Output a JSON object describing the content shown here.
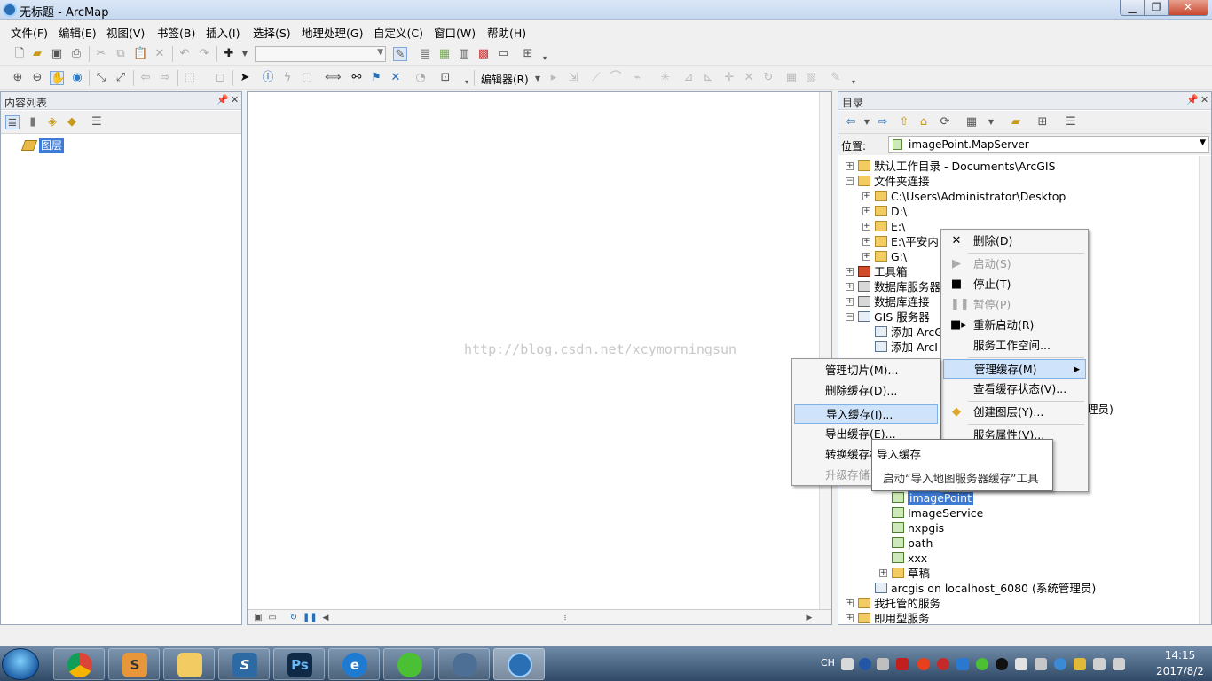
{
  "window": {
    "title": "无标题 - ArcMap"
  },
  "menubar": [
    "文件(F)",
    "编辑(E)",
    "视图(V)",
    "书签(B)",
    "插入(I)",
    "选择(S)",
    "地理处理(G)",
    "自定义(C)",
    "窗口(W)",
    "帮助(H)"
  ],
  "toolbar2": {
    "editor_label": "编辑器(R)"
  },
  "toc": {
    "title": "内容列表",
    "layers_label": "图层"
  },
  "catalog": {
    "title": "目录",
    "location_label": "位置:",
    "location_value": "imagePoint.MapServer",
    "tree": [
      {
        "label": "默认工作目录 - Documents\\ArcGIS",
        "icon": "folder-home-icon",
        "expand": "+"
      },
      {
        "label": "文件夹连接",
        "icon": "folder-connections-icon",
        "expand": "-"
      },
      {
        "label": "C:\\Users\\Administrator\\Desktop",
        "icon": "folder-icon",
        "expand": "+"
      },
      {
        "label": "D:\\",
        "icon": "folder-icon",
        "expand": "+"
      },
      {
        "label": "E:\\",
        "icon": "folder-icon",
        "expand": "+"
      },
      {
        "label": "E:\\平安内",
        "icon": "folder-icon",
        "expand": "+"
      },
      {
        "label": "G:\\",
        "icon": "folder-icon",
        "expand": "+"
      },
      {
        "label": "工具箱",
        "icon": "toolbox-icon",
        "expand": "+"
      },
      {
        "label": "数据库服务器",
        "icon": "database-server-icon",
        "expand": "+"
      },
      {
        "label": "数据库连接",
        "icon": "database-connection-icon",
        "expand": "+"
      },
      {
        "label": "GIS 服务器",
        "icon": "gis-server-icon",
        "expand": "-"
      },
      {
        "label": "添加 ArcG",
        "icon": "add-server-icon",
        "expand": ""
      },
      {
        "label": "添加 ArcI",
        "icon": "add-server-icon",
        "expand": ""
      },
      {
        "label": "imagePoint",
        "icon": "map-service-icon",
        "expand": ""
      },
      {
        "label": "ImageService",
        "icon": "map-service-icon",
        "expand": ""
      },
      {
        "label": "nxpgis",
        "icon": "map-service-icon",
        "expand": ""
      },
      {
        "label": "path",
        "icon": "map-service-icon",
        "expand": ""
      },
      {
        "label": "xxx",
        "icon": "map-service-icon",
        "expand": ""
      },
      {
        "label": "草稿",
        "icon": "folder-icon",
        "expand": "+"
      },
      {
        "label": "arcgis on localhost_6080 (系统管理员)",
        "icon": "server-connection-icon",
        "expand": ""
      },
      {
        "label": "我托管的服务",
        "icon": "folder-icon",
        "expand": "+"
      },
      {
        "label": "即用型服务",
        "icon": "folder-icon",
        "expand": "+"
      }
    ],
    "partial_text": "理员)"
  },
  "context_menu": {
    "items": [
      {
        "label": "删除(D)",
        "icon": "delete-x-icon",
        "disabled": false
      },
      {
        "label": "启动(S)",
        "icon": "play-icon",
        "disabled": true
      },
      {
        "label": "停止(T)",
        "icon": "stop-icon",
        "disabled": false
      },
      {
        "label": "暂停(P)",
        "icon": "pause-icon",
        "disabled": true
      },
      {
        "label": "重新启动(R)",
        "icon": "restart-icon",
        "disabled": false
      },
      {
        "label": "服务工作空间...",
        "icon": "",
        "disabled": false
      },
      {
        "label": "管理缓存(M)",
        "icon": "",
        "disabled": false,
        "highlighted": true,
        "submenu": true
      },
      {
        "label": "查看缓存状态(V)...",
        "icon": "",
        "disabled": false
      },
      {
        "label": "创建图层(Y)...",
        "icon": "create-layer-icon",
        "disabled": false
      },
      {
        "label": "服务属性(V)...",
        "icon": "",
        "disabled": false
      }
    ]
  },
  "submenu": {
    "items": [
      {
        "label": "管理切片(M)...",
        "disabled": false
      },
      {
        "label": "删除缓存(D)...",
        "disabled": false
      },
      {
        "label": "导入缓存(I)...",
        "disabled": false,
        "highlighted": true
      },
      {
        "label": "导出缓存(E)...",
        "disabled": false
      },
      {
        "label": "转换缓存格",
        "disabled": false
      },
      {
        "label": "升级存储",
        "disabled": true
      }
    ]
  },
  "tooltip": {
    "title": "导入缓存",
    "body": "启动“导入地图服务器缓存”工具"
  },
  "map": {
    "watermark": "http://blog.csdn.net/xcymorningsun"
  },
  "taskbar": {
    "apps": [
      "chrome",
      "sublime-text",
      "file-explorer",
      "scrivener",
      "photoshop",
      "internet-explorer",
      "wechat",
      "arccatalog",
      "arcmap"
    ],
    "ime": "CH",
    "time": "14:15",
    "date": "2017/8/2"
  },
  "colors": {
    "selection": "#3d7bd6",
    "menu_highlight": "#cfe3fb",
    "taskbar": "#2f4966"
  }
}
